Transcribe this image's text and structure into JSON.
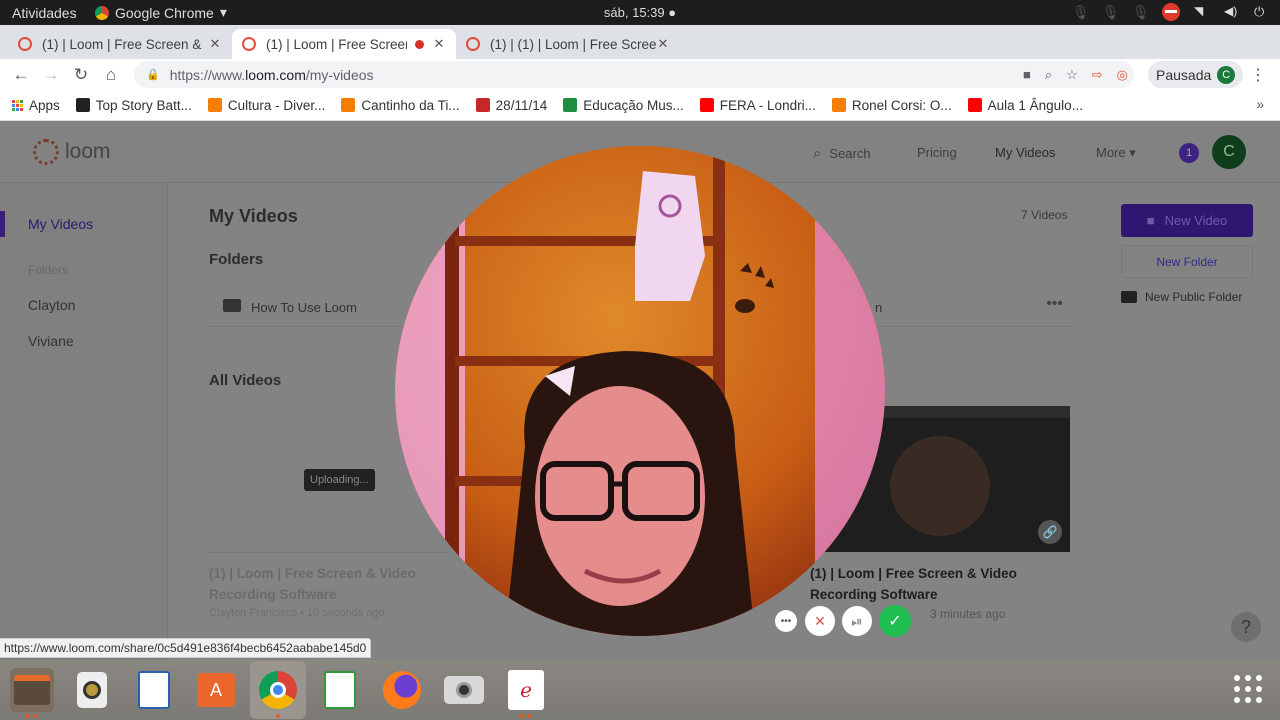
{
  "system": {
    "activities": "Atividades",
    "app_name": "Google Chrome",
    "clock": "sáb, 15:39 ●"
  },
  "tabs": [
    {
      "title": "(1) | Loom | Free Screen &"
    },
    {
      "title": "(1) | Loom | Free Screen"
    },
    {
      "title": "(1) | (1) | Loom | Free Scree"
    }
  ],
  "toolbar": {
    "url_prefix": "https://www.",
    "url_domain": "loom.com",
    "url_path": "/my-videos",
    "profile_label": "Pausada",
    "profile_initial": "C"
  },
  "bookmarks": [
    {
      "label": "Apps",
      "color": "#e8453c"
    },
    {
      "label": "Top Story Batt...",
      "color": "#222222"
    },
    {
      "label": "Cultura - Diver...",
      "color": "#f57d00"
    },
    {
      "label": "Cantinho da Ti...",
      "color": "#f57d00"
    },
    {
      "label": "28/11/14",
      "color": "#c62828"
    },
    {
      "label": "Educação Mus...",
      "color": "#1e8e3e"
    },
    {
      "label": "FERA - Londri...",
      "color": "#ff0000"
    },
    {
      "label": "Ronel Corsi: O...",
      "color": "#f57d00"
    },
    {
      "label": "Aula 1 Ângulo...",
      "color": "#ff0000"
    }
  ],
  "loom": {
    "brand": "loom",
    "nav": {
      "search": "Search",
      "pricing": "Pricing",
      "my_videos": "My Videos",
      "more": "More ▾"
    },
    "badge_count": "1",
    "user_initial": "C",
    "sidebar": {
      "my_videos": "My Videos",
      "folders_label": "Folders",
      "folders": [
        "Clayton",
        "Viviane"
      ]
    },
    "main": {
      "title": "My Videos",
      "count": "7 Videos",
      "folders_heading": "Folders",
      "folder_name": "How To Use Loom",
      "folder_name_2": "n",
      "all_videos_heading": "All Videos",
      "uploading": "Uploading...",
      "video_titles": [
        "(1) | Loom | Free Screen & Video Recording Software",
        "(1) | Loom | Free Screen & Video Recording Software"
      ],
      "video_meta": [
        "Clayton Francisco • 10 seconds ago",
        "3 minutes ago"
      ]
    },
    "actions": {
      "new_video": "New Video",
      "new_folder": "New Folder",
      "new_public_folder": "New Public Folder"
    },
    "help": "?"
  },
  "status_url": "https://www.loom.com/share/0c5d491e836f4becb6452aababe145d0"
}
